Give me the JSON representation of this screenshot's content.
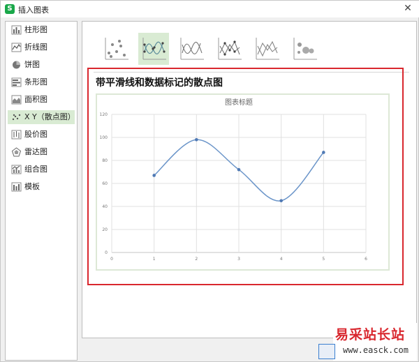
{
  "dialog": {
    "title": "插入图表",
    "close_glyph": "✕"
  },
  "sidebar": {
    "items": [
      {
        "label": "柱形图",
        "icon": "column-chart-icon"
      },
      {
        "label": "折线图",
        "icon": "line-chart-icon"
      },
      {
        "label": "饼图",
        "icon": "pie-chart-icon"
      },
      {
        "label": "条形图",
        "icon": "bar-chart-icon"
      },
      {
        "label": "面积图",
        "icon": "area-chart-icon"
      },
      {
        "label": "X Y（散点图）",
        "icon": "scatter-chart-icon",
        "selected": true
      },
      {
        "label": "股价图",
        "icon": "stock-chart-icon"
      },
      {
        "label": "雷达图",
        "icon": "radar-chart-icon"
      },
      {
        "label": "组合图",
        "icon": "combo-chart-icon"
      },
      {
        "label": "模板",
        "icon": "template-icon"
      }
    ]
  },
  "subtypes": [
    {
      "name": "scatter-markers",
      "selected": false
    },
    {
      "name": "scatter-smooth-lines-markers",
      "selected": true
    },
    {
      "name": "scatter-smooth-lines",
      "selected": false
    },
    {
      "name": "scatter-straight-lines-markers",
      "selected": false
    },
    {
      "name": "scatter-straight-lines",
      "selected": false
    },
    {
      "name": "bubble",
      "selected": false
    }
  ],
  "preview": {
    "title": "带平滑线和数据标记的散点图"
  },
  "chart_data": {
    "type": "scatter",
    "title": "图表标题",
    "x": [
      1,
      2,
      3,
      4,
      5
    ],
    "y": [
      67,
      98,
      72,
      45,
      87
    ],
    "xlim": [
      0,
      6
    ],
    "ylim": [
      0,
      120
    ],
    "xticks": [
      0,
      1,
      2,
      3,
      4,
      5,
      6
    ],
    "yticks": [
      0,
      20,
      40,
      60,
      80,
      100,
      120
    ],
    "grid": true,
    "line_style": "smooth",
    "markers": true,
    "color": "#6b95c9"
  },
  "watermark": {
    "line1": "易采站长站",
    "line2": "www.easck.com"
  },
  "colors": {
    "accent": "#d9272e",
    "selection": "#d9ebd3",
    "series": "#6b95c9"
  }
}
